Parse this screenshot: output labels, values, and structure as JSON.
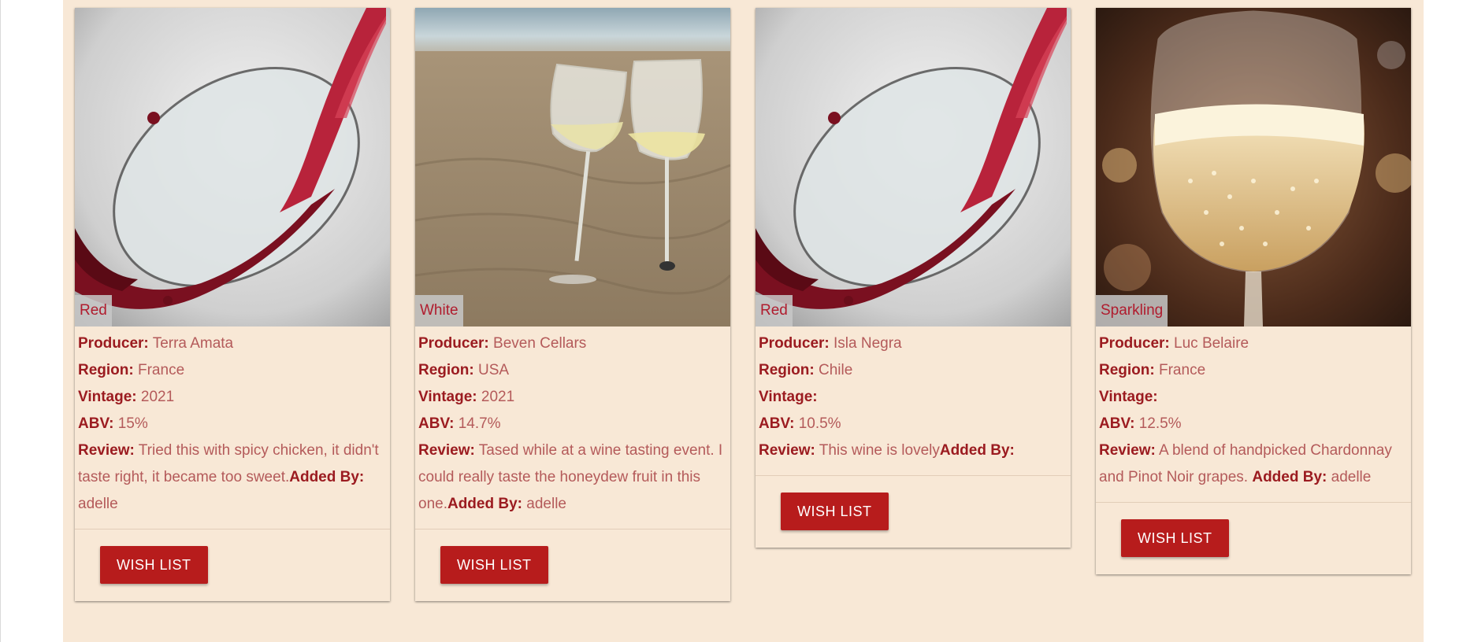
{
  "labels": {
    "producer": "Producer:",
    "region": "Region:",
    "vintage": "Vintage:",
    "abv": "ABV:",
    "review": "Review:",
    "added_by": "Added By:"
  },
  "colors": {
    "background": "#f8e8d6",
    "accent": "#b71c1c",
    "label": "#9b1b20",
    "value_text": "#b45a5a"
  },
  "wines": [
    {
      "type": "Red",
      "image": "red-wine-pour-image",
      "producer": "Terra Amata",
      "region": "France",
      "vintage": "2021",
      "abv": "15%",
      "review": "Tried this with spicy chicken, it didn't taste right, it became too sweet.",
      "added_by": "adelle",
      "button": "WISH LIST"
    },
    {
      "type": "White",
      "image": "white-wine-beach-image",
      "producer": "Beven Cellars",
      "region": "USA",
      "vintage": "2021",
      "abv": "14.7%",
      "review": "Tased while at a wine tasting event. I could really taste the honeydew fruit in this one.",
      "added_by": "adelle",
      "button": "WISH LIST"
    },
    {
      "type": "Red",
      "image": "red-wine-pour-image",
      "producer": "Isla Negra",
      "region": "Chile",
      "vintage": "",
      "abv": "10.5%",
      "review": "This wine is lovely",
      "added_by": "",
      "button": "WISH LIST"
    },
    {
      "type": "Sparkling",
      "image": "sparkling-wine-glass-image",
      "producer": "Luc Belaire",
      "region": "France",
      "vintage": "",
      "abv": "12.5%",
      "review": "A blend of handpicked Chardonnay and Pinot Noir grapes. ",
      "added_by": "adelle",
      "button": "WISH LIST"
    }
  ]
}
